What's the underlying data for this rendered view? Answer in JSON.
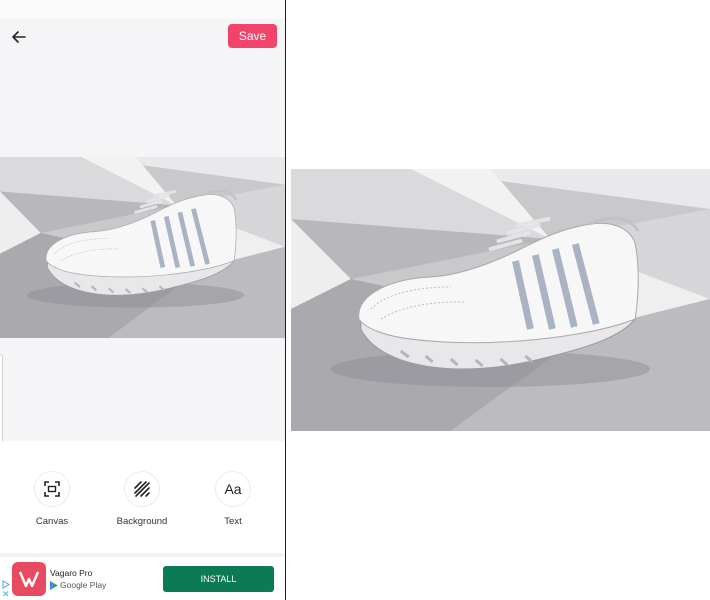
{
  "toolbar": {
    "back_icon": "arrow-left-icon",
    "save_label": "Save",
    "save_color": "#f2436a"
  },
  "tools": [
    {
      "label": "Canvas",
      "icon": "canvas-icon"
    },
    {
      "label": "Background",
      "icon": "background-icon"
    },
    {
      "label": "Text",
      "icon": "text-icon",
      "glyph": "Aa"
    }
  ],
  "ad": {
    "app_name": "Vagaro Pro",
    "store": "Google Play",
    "install_label": "INSTALL",
    "install_color": "#0b7a55"
  },
  "image": {
    "subject": "white sneaker on gray geometric background"
  }
}
